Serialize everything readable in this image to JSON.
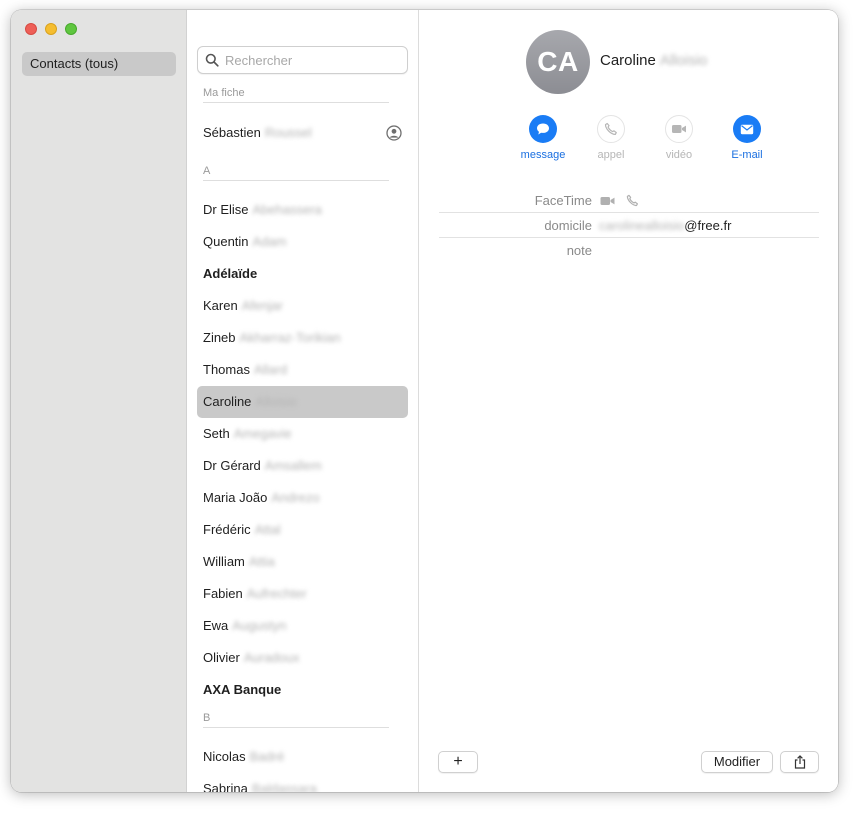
{
  "sidebar": {
    "window_controls": [
      "close",
      "minimize",
      "zoom"
    ],
    "items": [
      {
        "label": "Contacts (tous)",
        "selected": true
      }
    ]
  },
  "list": {
    "search_placeholder": "Rechercher",
    "my_card_header": "Ma fiche",
    "my_card": {
      "first": "Sébastien",
      "last": "Roussel"
    },
    "sections": [
      {
        "letter": "A",
        "contacts": [
          {
            "first": "Dr Elise",
            "last": "Abehassera"
          },
          {
            "first": "Quentin",
            "last": "Adam"
          },
          {
            "first": "Adélaïde",
            "last": "",
            "bold": true
          },
          {
            "first": "Karen",
            "last": "Afenjar"
          },
          {
            "first": "Zineb",
            "last": "Akharraz-Torikian"
          },
          {
            "first": "Thomas",
            "last": "Allard"
          },
          {
            "first": "Caroline",
            "last": "Alloisio",
            "selected": true
          },
          {
            "first": "Seth",
            "last": "Amegavie"
          },
          {
            "first": "Dr Gérard",
            "last": "Amsallem"
          },
          {
            "first": "Maria João",
            "last": "Andrezo"
          },
          {
            "first": "Frédéric",
            "last": "Attal"
          },
          {
            "first": "William",
            "last": "Attia"
          },
          {
            "first": "Fabien",
            "last": "Aufrechter"
          },
          {
            "first": "Ewa",
            "last": "Augustyn"
          },
          {
            "first": "Olivier",
            "last": "Auradoux"
          },
          {
            "first": "AXA Banque",
            "last": "",
            "bold": true
          }
        ]
      },
      {
        "letter": "B",
        "contacts": [
          {
            "first": "Nicolas",
            "last": "Badré"
          },
          {
            "first": "Sabrina",
            "last": "Baldassara"
          }
        ]
      }
    ]
  },
  "detail": {
    "initials": "CA",
    "first": "Caroline",
    "last": "Alloisio",
    "actions": [
      {
        "label": "message",
        "icon": "message-bubble-icon",
        "enabled": true
      },
      {
        "label": "appel",
        "icon": "phone-icon",
        "enabled": false
      },
      {
        "label": "vidéo",
        "icon": "video-camera-icon",
        "enabled": false
      },
      {
        "label": "E-mail",
        "icon": "envelope-icon",
        "enabled": true
      }
    ],
    "fields": [
      {
        "label": "FaceTime",
        "value": "",
        "icons": [
          "video-camera-icon",
          "phone-icon"
        ]
      },
      {
        "label": "domicile",
        "value_blurred": "carolinealloisio",
        "value": "@free.fr"
      },
      {
        "label": "note",
        "value": ""
      }
    ],
    "footer": {
      "add_label": "+",
      "edit_label": "Modifier",
      "share_icon": "share-icon"
    },
    "colors": {
      "accent": "#1a7cf5",
      "avatar": "#9a9ba0",
      "selection": "#c9c9c9"
    }
  }
}
